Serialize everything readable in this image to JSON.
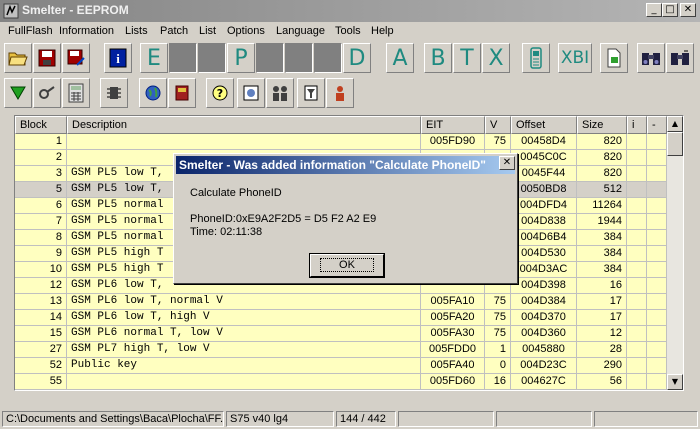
{
  "window": {
    "title": "Smelter - EEPROM",
    "min": "_",
    "max": "□",
    "close": "✕"
  },
  "menu": [
    "FullFlash",
    "Information",
    "Lists",
    "Patch",
    "List",
    "Options",
    "Language",
    "Tools",
    "Help"
  ],
  "toolbar1_letters": {
    "e": "E",
    "p": "P",
    "d": "D",
    "a": "A",
    "b": "B",
    "t": "T",
    "x": "X",
    "xbi": "XBI"
  },
  "grid": {
    "headers": [
      "Block",
      "Description",
      "EIT",
      "V",
      "Offset",
      "Size",
      "i",
      "-"
    ],
    "rows": [
      {
        "block": "1",
        "desc": "",
        "eit": "005FD90",
        "v": "75",
        "offset": "00458D4",
        "size": "820"
      },
      {
        "block": "2",
        "desc": "",
        "eit": "",
        "v": "",
        "offset": "0045C0C",
        "size": "820"
      },
      {
        "block": "3",
        "desc": "GSM PL5 low T,",
        "eit": "",
        "v": "",
        "offset": "0045F44",
        "size": "820"
      },
      {
        "block": "5",
        "desc": "GSM PL5 low T,",
        "eit": "",
        "v": "",
        "offset": "0050BD8",
        "size": "512"
      },
      {
        "block": "6",
        "desc": "GSM PL5 normal",
        "eit": "",
        "v": "",
        "offset": "004DFD4",
        "size": "11264"
      },
      {
        "block": "7",
        "desc": "GSM PL5 normal",
        "eit": "",
        "v": "",
        "offset": "004D838",
        "size": "1944"
      },
      {
        "block": "8",
        "desc": "GSM PL5 normal",
        "eit": "",
        "v": "",
        "offset": "004D6B4",
        "size": "384"
      },
      {
        "block": "9",
        "desc": "GSM PL5 high T",
        "eit": "",
        "v": "",
        "offset": "004D530",
        "size": "384"
      },
      {
        "block": "10",
        "desc": "GSM PL5 high T",
        "eit": "",
        "v": "",
        "offset": "004D3AC",
        "size": "384"
      },
      {
        "block": "12",
        "desc": "GSM PL6 low T,",
        "eit": "",
        "v": "",
        "offset": "004D398",
        "size": "16"
      },
      {
        "block": "13",
        "desc": "GSM PL6 low T, normal V",
        "eit": "005FA10",
        "v": "75",
        "offset": "004D384",
        "size": "17"
      },
      {
        "block": "14",
        "desc": "GSM PL6 low T, high V",
        "eit": "005FA20",
        "v": "75",
        "offset": "004D370",
        "size": "17"
      },
      {
        "block": "15",
        "desc": "GSM PL6 normal T, low V",
        "eit": "005FA30",
        "v": "75",
        "offset": "004D360",
        "size": "12"
      },
      {
        "block": "27",
        "desc": "GSM PL7 high T, low V",
        "eit": "005FDD0",
        "v": "1",
        "offset": "0045880",
        "size": "28"
      },
      {
        "block": "52",
        "desc": "Public key",
        "eit": "005FA40",
        "v": "0",
        "offset": "004D23C",
        "size": "290"
      },
      {
        "block": "55",
        "desc": "",
        "eit": "005FD60",
        "v": "16",
        "offset": "004627C",
        "size": "56"
      }
    ],
    "scroll_up": "▲",
    "scroll_down": "▼"
  },
  "status": {
    "path": "C:\\Documents and Settings\\Baca\\Plocha\\FF.b",
    "model": "S75 v40 lg4",
    "position": "144 / 442"
  },
  "dialog": {
    "title": "Smelter - Was added information \"Calculate PhoneID\"",
    "close": "✕",
    "line1": "Calculate PhoneID",
    "line2": "PhoneID:0xE9A2F2D5 = D5 F2 A2 E9",
    "line3": "Time: 02:11:38",
    "ok": "OK"
  }
}
